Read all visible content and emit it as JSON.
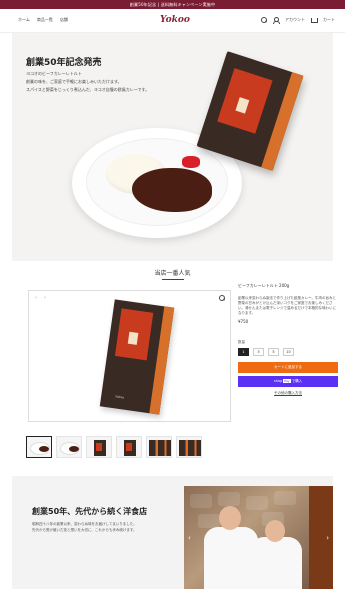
{
  "announce": "創業50年記念 | 送料無料キャンペーン実施中",
  "header": {
    "nav_left": [
      "ホーム",
      "商品一覧",
      "店舗"
    ],
    "logo": "Yokoo",
    "nav_right": [
      "アカウント",
      "カート"
    ]
  },
  "hero": {
    "title": "創業50年記念発売",
    "lines": [
      "ヨコオのビーフカレーレトルト",
      "創業の味を、ご家庭で手軽にお楽しみいただけます。",
      "スパイスと野菜をじっくり煮込んだ、ヨコオ自慢の欧風カレーです。"
    ]
  },
  "section": {
    "title": "当店一番人気"
  },
  "gallery": {
    "prev": "‹",
    "next": "›",
    "box_brand": "Yokoo"
  },
  "product": {
    "title": "ビーフカレーレトルト 200g",
    "description": "創業以来変わらぬ製法で作り上げた欧風カレー。牛肉の旨みと野菜の甘みがとけ込んだ深いコクをご家庭でお楽しみください。湯せんまたは電子レンジで温めるだけで本格的な味わいになります。",
    "price": "¥750",
    "qty_label": "数量",
    "qty_options": [
      "1",
      "3",
      "5",
      "10"
    ],
    "qty_selected": "1",
    "add_to_cart": "カートに追加する",
    "shop_pay_prefix": "shop",
    "shop_pay_badge": "Pay",
    "shop_pay_suffix": "で購入",
    "more_payment": "その他の購入方法"
  },
  "thumbs": [
    "dish",
    "dish",
    "box",
    "box",
    "multi",
    "multi",
    "multi"
  ],
  "story": {
    "title": "創業50年、先代から続く洋食店",
    "lines": [
      "昭和四十八年の創業以来、変わらぬ味をお届けしてまいりました。",
      "先代から受け継いだ技と想いを大切に、これからも歩み続けます。"
    ],
    "next": "›",
    "prev": "‹"
  },
  "colors": {
    "brand": "#8a2235",
    "cart_button": "#ef6b12",
    "shop_pay": "#5a31f4"
  }
}
